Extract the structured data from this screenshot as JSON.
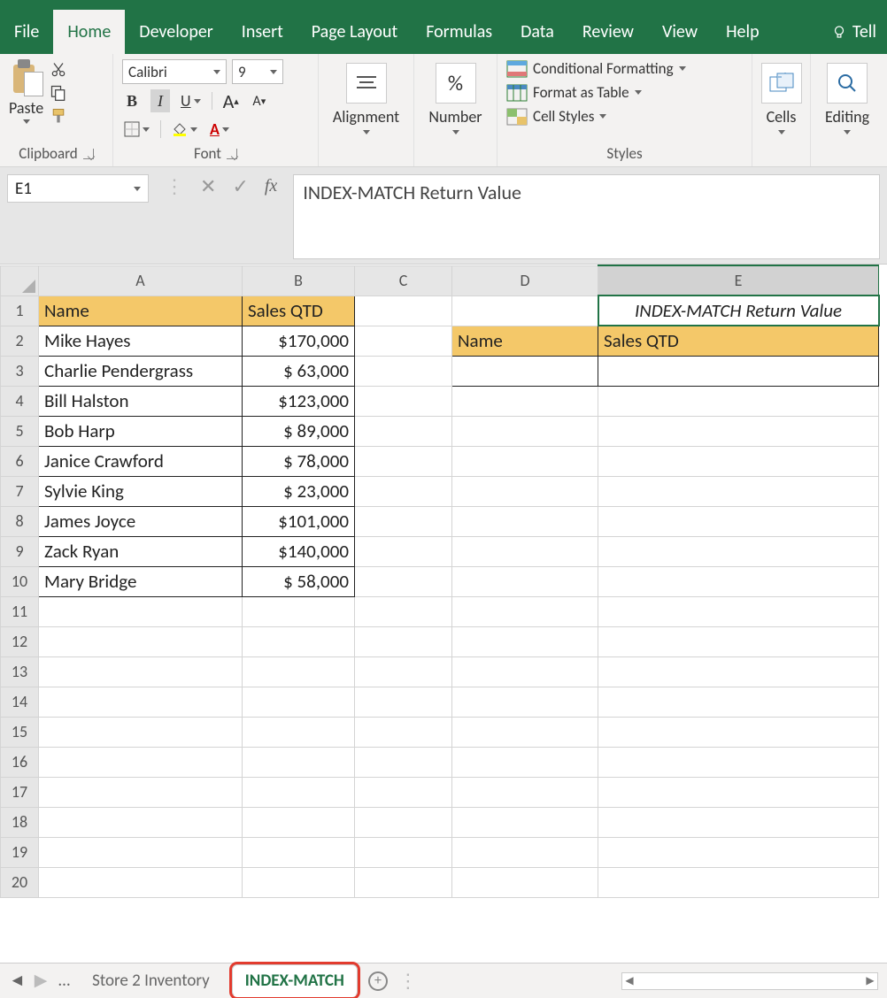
{
  "tabs": {
    "file": "File",
    "home": "Home",
    "developer": "Developer",
    "insert": "Insert",
    "page_layout": "Page Layout",
    "formulas": "Formulas",
    "data": "Data",
    "review": "Review",
    "view": "View",
    "help": "Help",
    "tell": "Tell"
  },
  "ribbon": {
    "clipboard": {
      "paste": "Paste",
      "label": "Clipboard"
    },
    "font": {
      "name": "Calibri",
      "size": "9",
      "bold": "B",
      "italic": "I",
      "underline": "U",
      "grow": "A",
      "shrink": "A",
      "label": "Font"
    },
    "alignment": {
      "label": "Alignment"
    },
    "number": {
      "symbol": "%",
      "label": "Number"
    },
    "styles": {
      "cond": "Conditional Formatting",
      "table": "Format as Table",
      "cell": "Cell Styles",
      "label": "Styles"
    },
    "cells": {
      "label": "Cells"
    },
    "editing": {
      "label": "Editing"
    }
  },
  "formula_bar": {
    "cell_ref": "E1",
    "fx": "fx",
    "value": "INDEX-MATCH Return Value"
  },
  "columns": [
    "A",
    "B",
    "C",
    "D",
    "E"
  ],
  "widths": {
    "rh": 43,
    "A": 230,
    "B": 127,
    "C": 110,
    "D": 165,
    "E": 317
  },
  "rows": [
    "1",
    "2",
    "3",
    "4",
    "5",
    "6",
    "7",
    "8",
    "9",
    "10",
    "11",
    "12",
    "13",
    "14",
    "15",
    "16",
    "17",
    "18",
    "19",
    "20"
  ],
  "cells": {
    "A1": "Name",
    "B1": "Sales QTD",
    "A2": "Mike Hayes",
    "B2": "$170,000",
    "A3": "Charlie Pendergrass",
    "B3": "$  63,000",
    "A4": "Bill Halston",
    "B4": "$123,000",
    "A5": "Bob Harp",
    "B5": "$  89,000",
    "A6": "Janice Crawford",
    "B6": "$  78,000",
    "A7": "Sylvie King",
    "B7": "$  23,000",
    "A8": "James Joyce",
    "B8": "$101,000",
    "A9": "Zack Ryan",
    "B9": "$140,000",
    "A10": "Mary Bridge",
    "B10": "$  58,000",
    "E1": "INDEX-MATCH Return Value",
    "D2": "Name",
    "E2": "Sales QTD"
  },
  "sheet_tabs": {
    "prev": "◄",
    "next": "▶",
    "more": "…",
    "tab1": "Store 2 Inventory",
    "tab2": "INDEX-MATCH",
    "add": "+"
  }
}
